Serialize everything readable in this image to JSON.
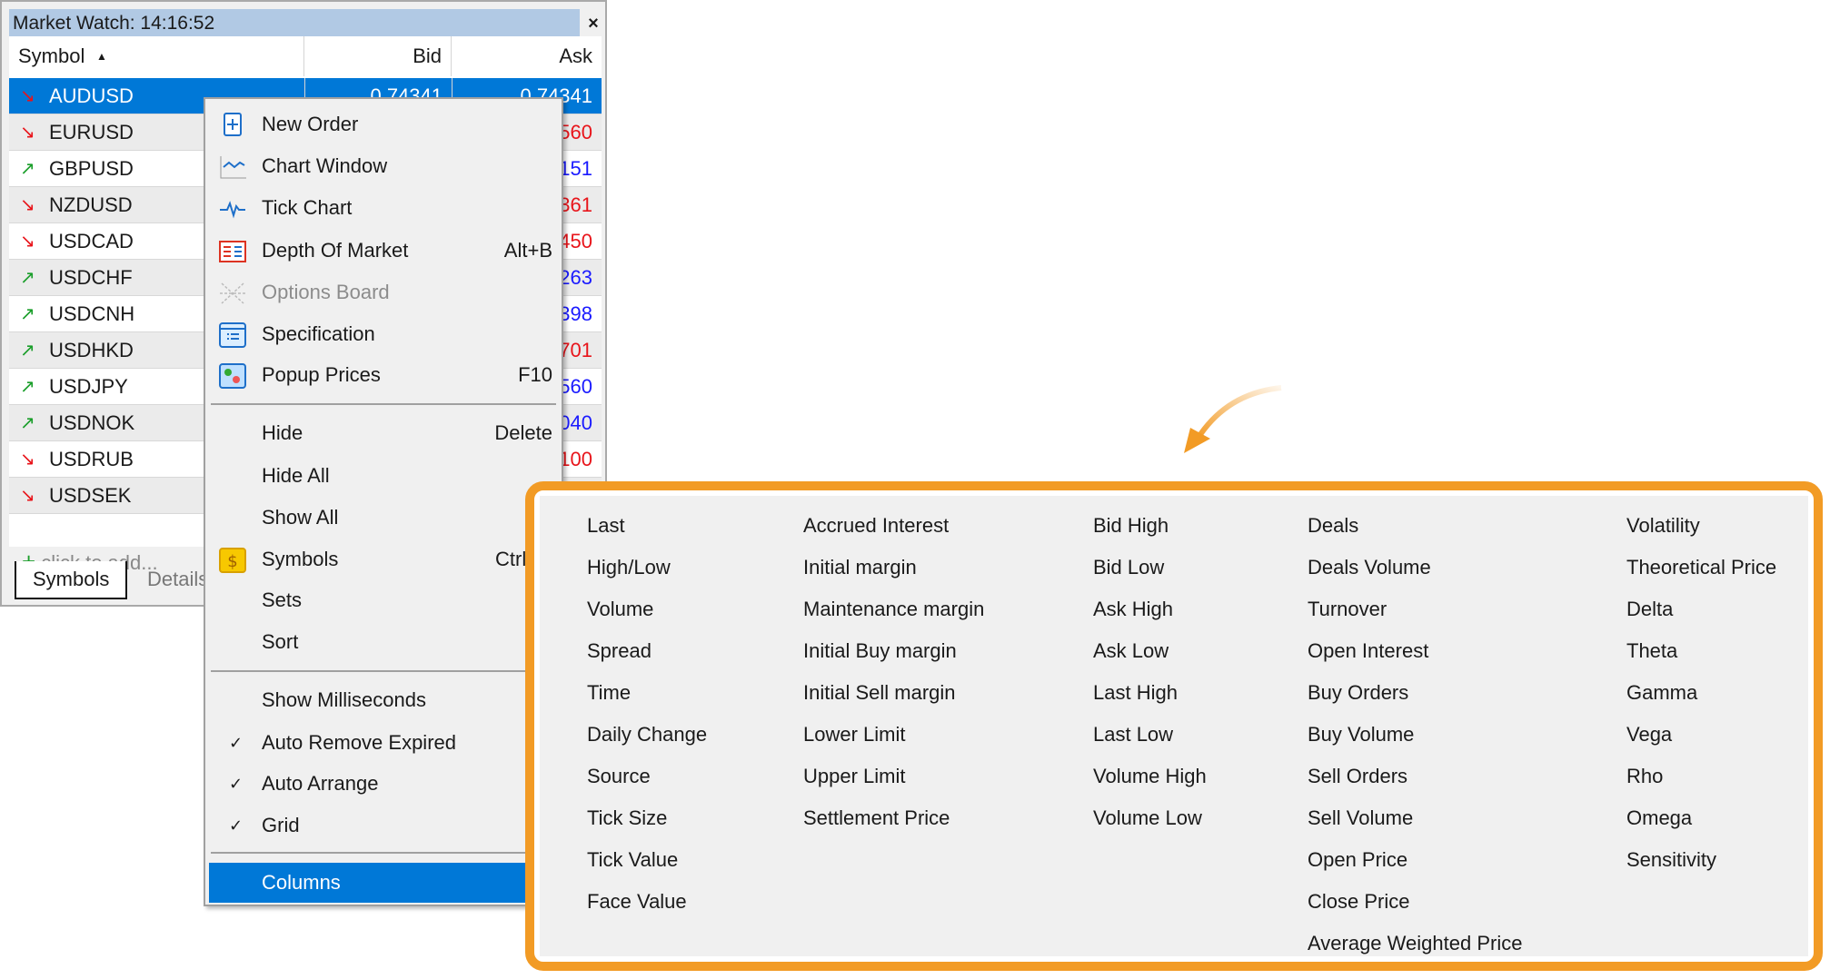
{
  "window": {
    "title": "Market Watch: 14:16:52",
    "close": "×"
  },
  "table": {
    "headers": {
      "symbol": "Symbol",
      "sort": "▲",
      "bid": "Bid",
      "ask": "Ask"
    },
    "rows": [
      {
        "symbol": "AUDUSD",
        "dir": "down",
        "bid": "0.74341",
        "ask": "0.74341",
        "ask_color": "#ffffff"
      },
      {
        "symbol": "EURUSD",
        "dir": "down",
        "bid": "",
        "ask": "560",
        "ask_color": "#e8141a"
      },
      {
        "symbol": "GBPUSD",
        "dir": "up",
        "bid": "",
        "ask": "151",
        "ask_color": "#1a1aff"
      },
      {
        "symbol": "NZDUSD",
        "dir": "down",
        "bid": "",
        "ask": "361",
        "ask_color": "#e8141a"
      },
      {
        "symbol": "USDCAD",
        "dir": "down",
        "bid": "",
        "ask": "450",
        "ask_color": "#e8141a"
      },
      {
        "symbol": "USDCHF",
        "dir": "up",
        "bid": "",
        "ask": "263",
        "ask_color": "#1a1aff"
      },
      {
        "symbol": "USDCNH",
        "dir": "up",
        "bid": "",
        "ask": "398",
        "ask_color": "#1a1aff"
      },
      {
        "symbol": "USDHKD",
        "dir": "up",
        "bid": "",
        "ask": "701",
        "ask_color": "#e8141a"
      },
      {
        "symbol": "USDJPY",
        "dir": "up",
        "bid": "",
        "ask": "560",
        "ask_color": "#1a1aff"
      },
      {
        "symbol": "USDNOK",
        "dir": "up",
        "bid": "",
        "ask": "040",
        "ask_color": "#1a1aff"
      },
      {
        "symbol": "USDRUB",
        "dir": "down",
        "bid": "",
        "ask": "100",
        "ask_color": "#e8141a"
      },
      {
        "symbol": "USDSEK",
        "dir": "down",
        "bid": "",
        "ask": "",
        "ask_color": "#e8141a"
      }
    ],
    "add_row": "click to add..."
  },
  "tabs": [
    {
      "label": "Symbols",
      "active": true
    },
    {
      "label": "Details",
      "active": false
    }
  ],
  "menu": {
    "items": [
      {
        "label": "New Order",
        "icon": "new-order-icon",
        "shortcut": ""
      },
      {
        "label": "Chart Window",
        "icon": "chart-window-icon",
        "shortcut": ""
      },
      {
        "label": "Tick Chart",
        "icon": "tick-chart-icon",
        "shortcut": ""
      },
      {
        "label": "Depth Of Market",
        "icon": "depth-of-market-icon",
        "shortcut": "Alt+B"
      },
      {
        "label": "Options Board",
        "icon": "options-board-icon",
        "shortcut": "",
        "disabled": true
      },
      {
        "label": "Specification",
        "icon": "specification-icon",
        "shortcut": ""
      },
      {
        "label": "Popup Prices",
        "icon": "popup-prices-icon",
        "shortcut": "F10"
      },
      {
        "label": "Hide",
        "shortcut": "Delete"
      },
      {
        "label": "Hide All",
        "shortcut": ""
      },
      {
        "label": "Show All",
        "shortcut": ""
      },
      {
        "label": "Symbols",
        "icon": "dollar-icon",
        "shortcut": "Ctrl+U"
      },
      {
        "label": "Sets",
        "shortcut": ""
      },
      {
        "label": "Sort",
        "shortcut": ""
      },
      {
        "label": "Show Milliseconds",
        "checked": false
      },
      {
        "label": "Auto Remove Expired",
        "checked": true
      },
      {
        "label": "Auto Arrange",
        "checked": true
      },
      {
        "label": "Grid",
        "checked": true
      },
      {
        "label": "Columns",
        "highlighted": true
      }
    ],
    "check": "✓"
  },
  "columns_panel": {
    "columns": [
      [
        "Last",
        "High/Low",
        "Volume",
        "Spread",
        "Time",
        "Daily Change",
        "Source",
        "Tick Size",
        "Tick Value",
        "Face Value"
      ],
      [
        "Accrued Interest",
        "Initial margin",
        "Maintenance margin",
        "Initial Buy margin",
        "Initial Sell margin",
        "Lower Limit",
        "Upper Limit",
        "Settlement Price"
      ],
      [
        "Bid High",
        "Bid Low",
        "Ask High",
        "Ask Low",
        "Last High",
        "Last Low",
        "Volume High",
        "Volume Low"
      ],
      [
        "Deals",
        "Deals Volume",
        "Turnover",
        "Open Interest",
        "Buy Orders",
        "Buy Volume",
        "Sell Orders",
        "Sell Volume",
        "Open Price",
        "Close Price",
        "Average Weighted Price"
      ],
      [
        "Volatility",
        "Theoretical Price",
        "Delta",
        "Theta",
        "Gamma",
        "Vega",
        "Rho",
        "Omega",
        "Sensitivity"
      ]
    ]
  },
  "colors": {
    "accent": "#0078d7",
    "highlight_border": "#f29b25",
    "up": "#1a9e2a",
    "down": "#e8141a"
  }
}
